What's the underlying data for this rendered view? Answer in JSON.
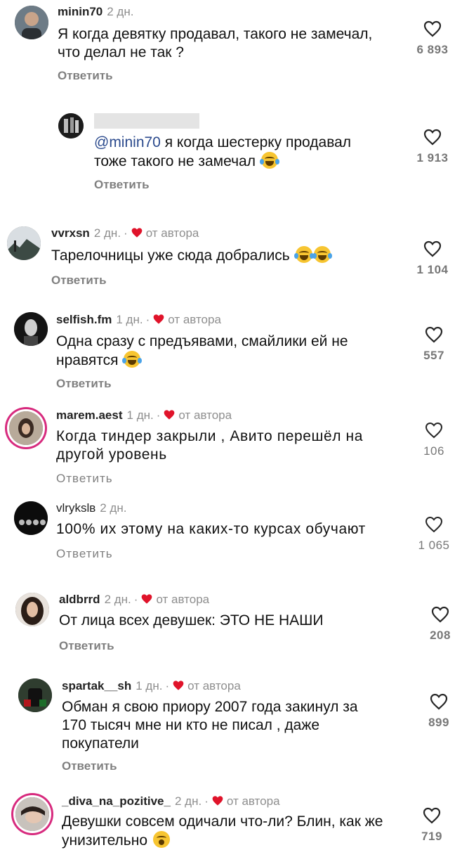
{
  "reply_label": "Ответить",
  "author_label": "от автора",
  "comments": [
    {
      "user": "minin70",
      "date": "2 дн.",
      "line1": "Я когда девятку продавал, такого не замечал,",
      "line2": "что делал не так ?",
      "likes": "6 893"
    },
    {
      "mention": "@minin70",
      "line1_rest": " я когда шестерку продавал",
      "line2": "тоже такого не замечал",
      "likes": "1 913"
    },
    {
      "user": "vvrxsn",
      "date": "2 дн.",
      "line1": "Тарелочницы уже сюда добрались",
      "likes": "1 104"
    },
    {
      "user": "selfish.fm",
      "date": "1 дн.",
      "line1": "Одна сразу с предъявами, смайлики ей не",
      "line2": "нравятся",
      "likes": "557"
    },
    {
      "user": "marem.aest",
      "date": "1 дн.",
      "line1": "Когда тиндер закрыли , Авито перешёл на",
      "line2": "другой уровень",
      "likes": "106"
    },
    {
      "user": "vlrykslв",
      "date": "2 дн.",
      "line1": "100% их этому на каких-то курсах обучают",
      "likes": "1 065"
    },
    {
      "user": "aldbrrd",
      "date": "2 дн.",
      "line1": "От лица всех девушек: ЭТО НЕ НАШИ",
      "likes": "208"
    },
    {
      "user": "spartak__sh",
      "date": "1 дн.",
      "line1": "Обман я свою приору 2007 года закинул за",
      "line2": "170 тысяч мне ни кто не писал , даже",
      "line3": "покупатели",
      "likes": "899"
    },
    {
      "user": "_diva_na_pozitive_",
      "date": "2 дн.",
      "line1": "Девушки совсем одичали что-ли? Блин, как же",
      "line2": "унизительно",
      "likes": "719"
    }
  ],
  "colors": {
    "heart_red": "#e0132a",
    "accent_mention": "#2b4a8d",
    "story_ring": "#d72b7e"
  },
  "icons": {
    "like": "heart-outline-icon",
    "author_like": "heart-filled-icon"
  }
}
